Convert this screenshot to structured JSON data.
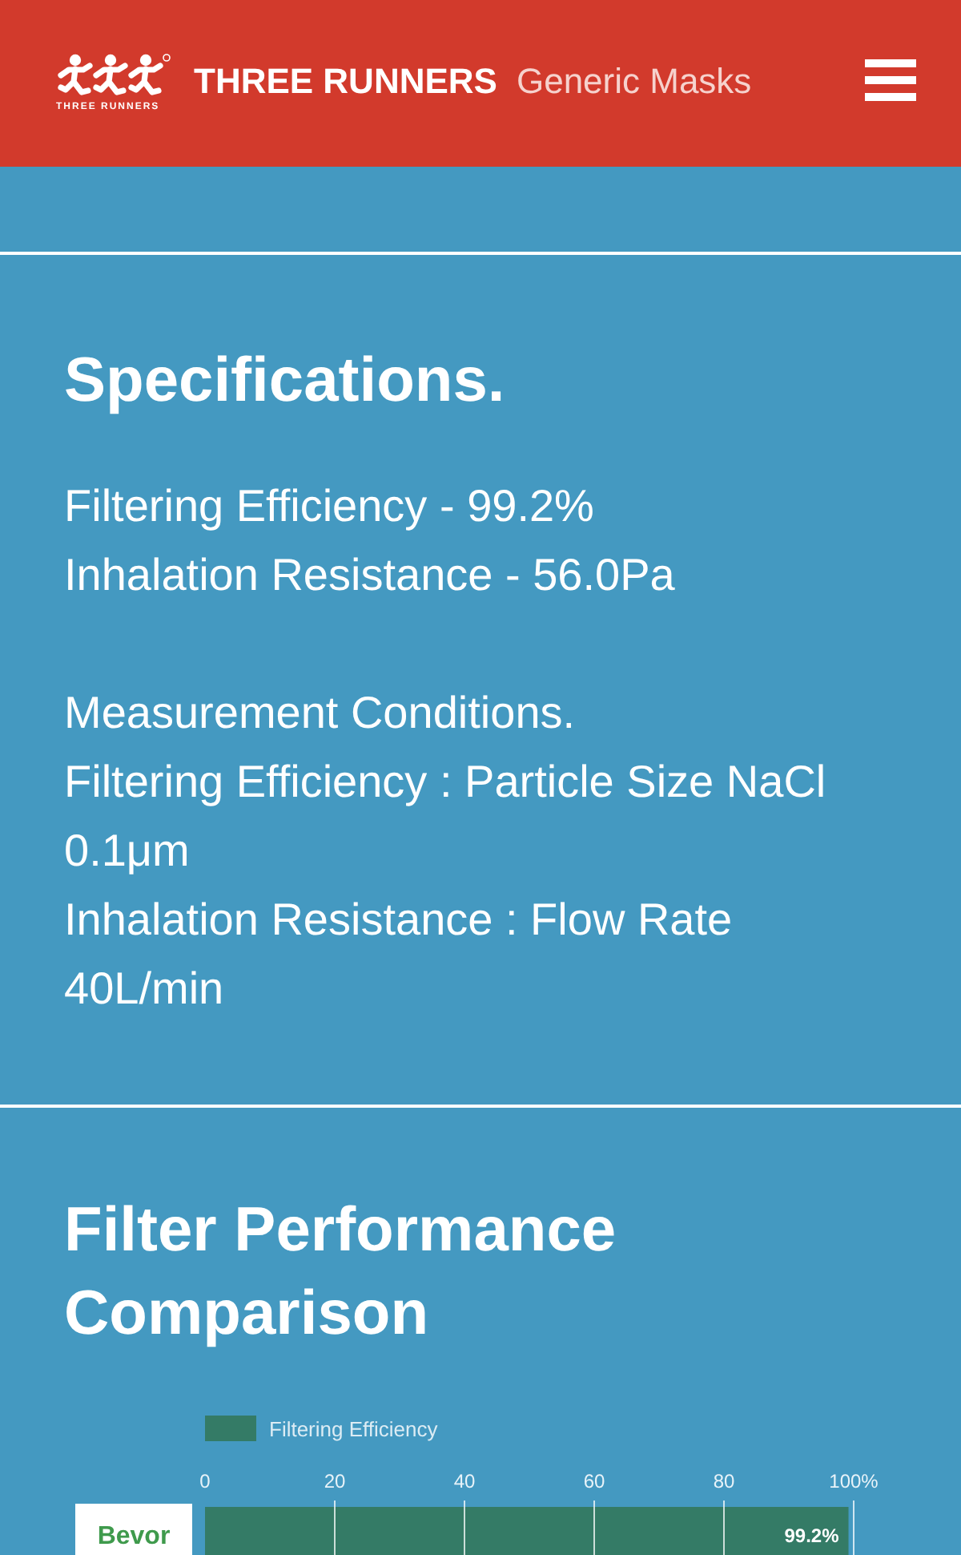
{
  "header": {
    "logo_caption": "THREE RUNNERS",
    "brand": "THREE RUNNERS",
    "subtitle": "Generic Masks"
  },
  "specifications": {
    "title": "Specifications.",
    "values": [
      "Filtering Efficiency - 99.2%",
      "Inhalation Resistance - 56.0Pa"
    ],
    "conditions": [
      "Measurement Conditions.",
      "Filtering Efficiency : Particle Size NaCl 0.1μm",
      "Inhalation Resistance : Flow Rate 40L/min"
    ]
  },
  "performance": {
    "title": "Filter Performance Comparison",
    "chart_data": {
      "type": "bar",
      "orientation": "horizontal",
      "categories": [
        "Bevor"
      ],
      "series": [
        {
          "name": "Filtering Efficiency",
          "color": "#347b66",
          "values": [
            99.2
          ]
        }
      ],
      "xlim": [
        0,
        100
      ],
      "xticks": [
        0,
        20,
        40,
        60,
        80,
        {
          "value": 100,
          "label": "100%"
        }
      ],
      "value_labels": [
        "99.2%"
      ]
    }
  }
}
